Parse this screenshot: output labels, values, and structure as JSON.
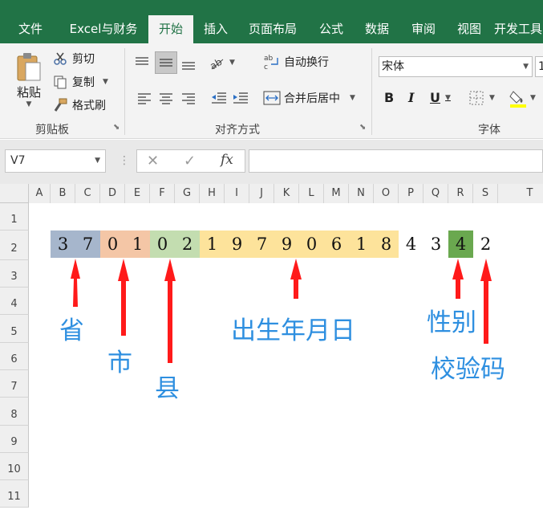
{
  "ribbon_tabs": [
    "文件",
    "Excel与财务",
    "开始",
    "插入",
    "页面布局",
    "公式",
    "数据",
    "审阅",
    "视图",
    "开发工具"
  ],
  "active_tab": "开始",
  "clipboard": {
    "paste": "粘贴",
    "cut": "剪切",
    "copy": "复制",
    "format_painter": "格式刷",
    "group_label": "剪贴板"
  },
  "alignment": {
    "wrap_text": "自动换行",
    "merge_center": "合并后居中",
    "group_label": "对齐方式"
  },
  "font": {
    "font_name": "宋体",
    "font_size": "1",
    "bold": "B",
    "italic": "I",
    "underline": "U",
    "group_label": "字体"
  },
  "formula_bar": {
    "name_box": "V7",
    "fx": "fx"
  },
  "columns": [
    "A",
    "B",
    "C",
    "D",
    "E",
    "F",
    "G",
    "H",
    "I",
    "J",
    "K",
    "L",
    "M",
    "N",
    "O",
    "P",
    "Q",
    "R",
    "S",
    "T"
  ],
  "rows": [
    "1",
    "2",
    "3",
    "4",
    "5",
    "6",
    "7",
    "8",
    "9",
    "10",
    "11"
  ],
  "id_digits": [
    "3",
    "7",
    "0",
    "1",
    "0",
    "2",
    "1",
    "9",
    "7",
    "9",
    "0",
    "6",
    "1",
    "8",
    "4",
    "3",
    "4",
    "2"
  ],
  "segment_colors": {
    "province": "#a6b6cc",
    "city": "#f4c6a6",
    "county": "#c3ddb0",
    "birthdate": "#fde39b",
    "gender": "#6aa84f"
  },
  "annotations": {
    "province": "省",
    "city": "市",
    "county": "县",
    "birthdate": "出生年月日",
    "gender": "性别",
    "check_digit": "校验码"
  }
}
